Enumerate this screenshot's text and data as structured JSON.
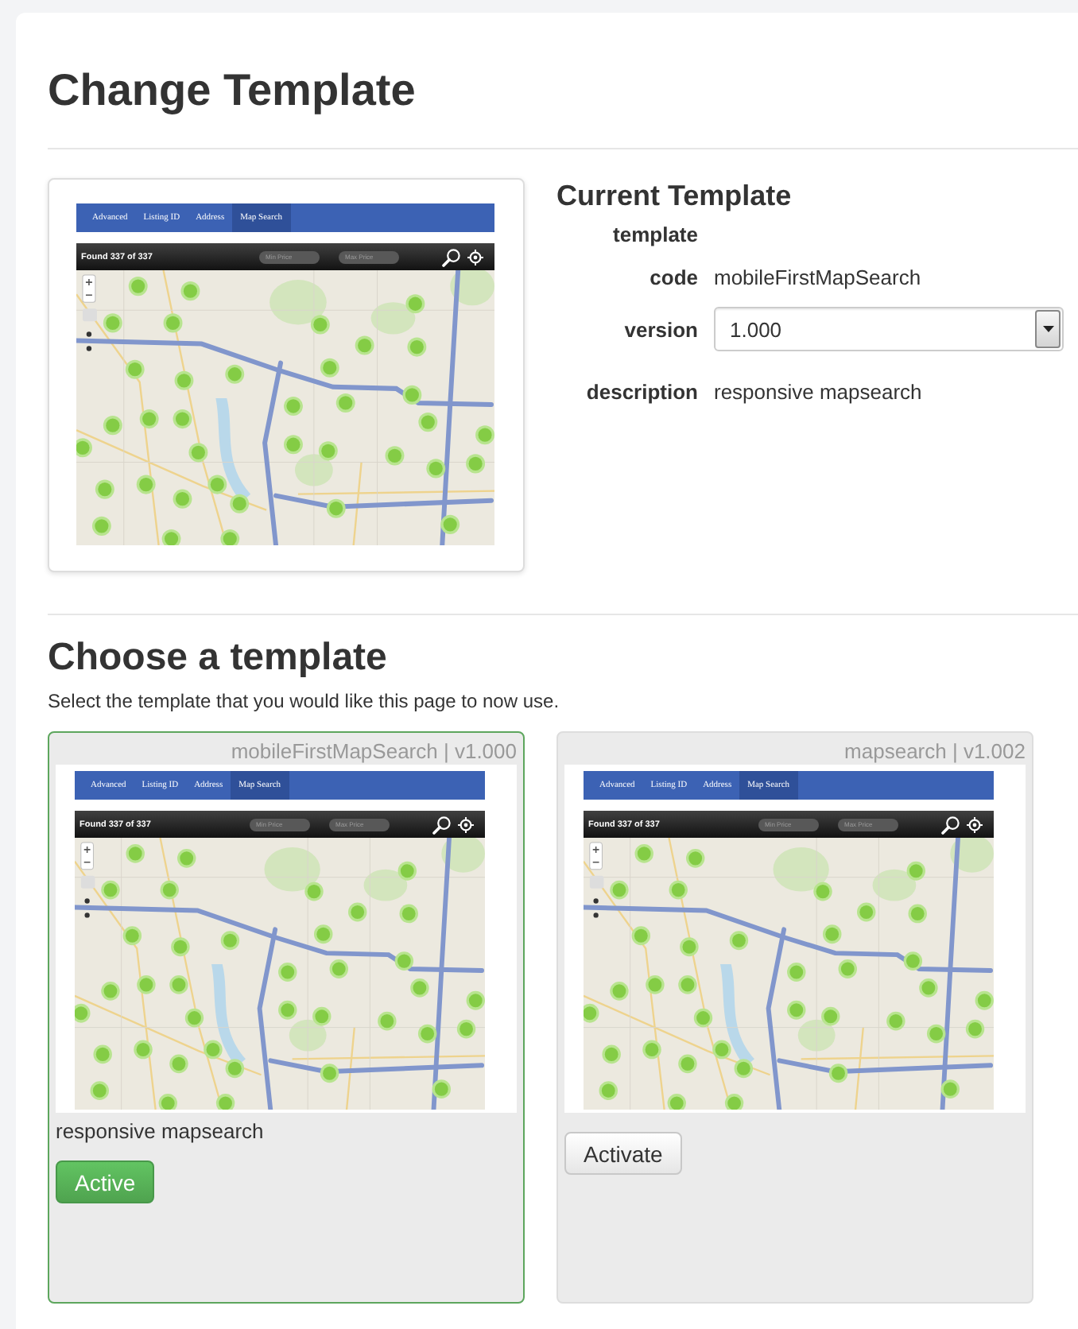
{
  "page": {
    "title": "Change Template"
  },
  "current_template": {
    "title": "Current Template",
    "preview": {
      "tabs": [
        {
          "label": "Advanced",
          "selected": false
        },
        {
          "label": "Listing ID",
          "selected": false
        },
        {
          "label": "Address",
          "selected": false
        },
        {
          "label": "Map Search",
          "selected": true
        }
      ],
      "result_count": "Found 337 of 337",
      "min_price": {
        "placeholder": "Min Price"
      },
      "max_price": {
        "placeholder": "Max Price"
      }
    },
    "fields": [
      {
        "kind": "text",
        "label": "template"
      },
      {
        "kind": "text",
        "label": "code",
        "value": "mobileFirstMapSearch"
      },
      {
        "kind": "select",
        "label": "version",
        "value": "1.000"
      },
      {
        "kind": "text",
        "label": "description",
        "value": "responsive mapsearch"
      }
    ]
  },
  "chooser": {
    "title": "Choose a template",
    "subtitle": "Select the template that you would like this page to now use.",
    "templates": [
      {
        "title": "mobileFirstMapSearch | v1.000",
        "selected": true,
        "preview": {
          "tabs": [
            {
              "label": "Advanced",
              "selected": false
            },
            {
              "label": "Listing ID",
              "selected": false
            },
            {
              "label": "Address",
              "selected": false
            },
            {
              "label": "Map Search",
              "selected": true
            }
          ],
          "result_count": "Found 337 of 337",
          "min_price": {
            "placeholder": "Min Price"
          },
          "max_price": {
            "placeholder": "Max Price"
          }
        },
        "description": "responsive mapsearch",
        "button": "Active"
      },
      {
        "title": "mapsearch | v1.002",
        "selected": false,
        "preview": {
          "tabs": [
            {
              "label": "Advanced",
              "selected": false
            },
            {
              "label": "Listing ID",
              "selected": false
            },
            {
              "label": "Address",
              "selected": false
            },
            {
              "label": "Map Search",
              "selected": true
            }
          ],
          "result_count": "Found 337 of 337",
          "min_price": {
            "placeholder": "Min Price"
          },
          "max_price": {
            "placeholder": "Max Price"
          }
        },
        "button": "Activate"
      }
    ]
  }
}
